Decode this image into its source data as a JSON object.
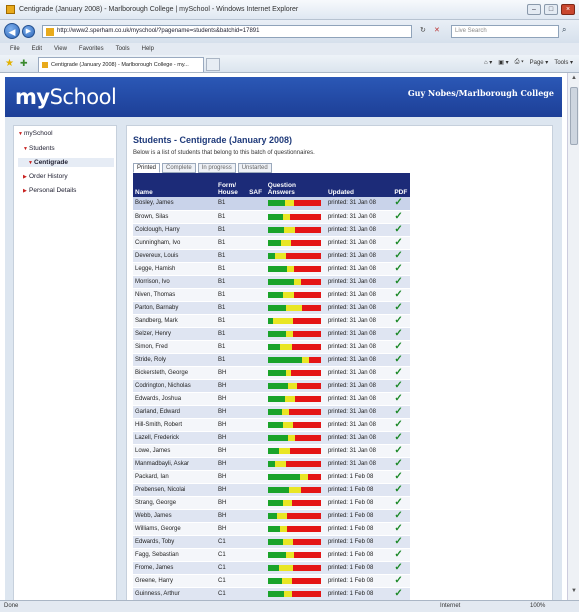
{
  "window": {
    "title": "Centigrade (January 2008) - Marlborough College | mySchool - Windows Internet Explorer",
    "min": "–",
    "max": "□",
    "close": "×"
  },
  "address_bar": {
    "url": "http://www2.sperham.co.uk/myschool/?pagename=students&batchid=17891",
    "search_placeholder": "Live Search",
    "refresh_glyph": "↻",
    "stop_glyph": "✕",
    "search_glyph": "⌕"
  },
  "menu": [
    "File",
    "Edit",
    "View",
    "Favorites",
    "Tools",
    "Help"
  ],
  "favorites_bar": {
    "tab_title": "Centigrade (January 2008) - Marlborough College - my...",
    "commands": [
      "Page ▾",
      "Tools ▾"
    ]
  },
  "header": {
    "logo_bold": "my",
    "logo_rest": "School",
    "user_college": "Guy Nobes/Marlborough College"
  },
  "sidebar": {
    "items": [
      {
        "label": "mySchool"
      },
      {
        "label": "Students"
      },
      {
        "label": "Centigrade"
      },
      {
        "label": "Order History"
      },
      {
        "label": "Personal Details"
      }
    ]
  },
  "main": {
    "title": "Students - Centigrade (January 2008)",
    "description": "Below is a list of students that belong to this batch of questionnaires.",
    "tabs": [
      "Printed",
      "Complete",
      "In progress",
      "Unstarted"
    ],
    "columns": {
      "name": "Name",
      "form": "Form/\nHouse",
      "saf": "SAF",
      "answers": "Question\nAnswers",
      "updated": "Updated",
      "pdf": "PDF"
    },
    "rows": [
      {
        "name": "Bosley, James",
        "form": "B1",
        "updated": "printed: 31 Jan 08",
        "bar": [
          0.33,
          0.16,
          0.51
        ]
      },
      {
        "name": "Brown, Silas",
        "form": "B1",
        "updated": "printed: 31 Jan 08",
        "bar": [
          0.28,
          0.14,
          0.58
        ]
      },
      {
        "name": "Colclough, Harry",
        "form": "B1",
        "updated": "printed: 31 Jan 08",
        "bar": [
          0.3,
          0.22,
          0.48
        ]
      },
      {
        "name": "Cunningham, Ivo",
        "form": "B1",
        "updated": "printed: 31 Jan 08",
        "bar": [
          0.25,
          0.18,
          0.57
        ]
      },
      {
        "name": "Devereux, Louis",
        "form": "B1",
        "updated": "printed: 31 Jan 08",
        "bar": [
          0.14,
          0.2,
          0.66
        ]
      },
      {
        "name": "Legge, Hamish",
        "form": "B1",
        "updated": "printed: 31 Jan 08",
        "bar": [
          0.36,
          0.14,
          0.5
        ]
      },
      {
        "name": "Morrison, Ivo",
        "form": "B1",
        "updated": "printed: 31 Jan 08",
        "bar": [
          0.5,
          0.12,
          0.38
        ]
      },
      {
        "name": "Niven, Thomas",
        "form": "B1",
        "updated": "printed: 31 Jan 08",
        "bar": [
          0.28,
          0.22,
          0.5
        ]
      },
      {
        "name": "Parton, Barnaby",
        "form": "B1",
        "updated": "printed: 31 Jan 08",
        "bar": [
          0.35,
          0.3,
          0.35
        ]
      },
      {
        "name": "Sandberg, Mark",
        "form": "B1",
        "updated": "printed: 31 Jan 08",
        "bar": [
          0.1,
          0.38,
          0.52
        ]
      },
      {
        "name": "Selzer, Henry",
        "form": "B1",
        "updated": "printed: 31 Jan 08",
        "bar": [
          0.35,
          0.12,
          0.53
        ]
      },
      {
        "name": "Simon, Fred",
        "form": "B1",
        "updated": "printed: 31 Jan 08",
        "bar": [
          0.24,
          0.22,
          0.54
        ]
      },
      {
        "name": "Stride, Roly",
        "form": "B1",
        "updated": "printed: 31 Jan 08",
        "bar": [
          0.65,
          0.12,
          0.23
        ]
      },
      {
        "name": "Bickersteth, George",
        "form": "BH",
        "updated": "printed: 31 Jan 08",
        "bar": [
          0.34,
          0.1,
          0.56
        ]
      },
      {
        "name": "Codrington, Nicholas",
        "form": "BH",
        "updated": "printed: 31 Jan 08",
        "bar": [
          0.38,
          0.18,
          0.44
        ]
      },
      {
        "name": "Edwards, Joshua",
        "form": "BH",
        "updated": "printed: 31 Jan 08",
        "bar": [
          0.32,
          0.2,
          0.48
        ]
      },
      {
        "name": "Garland, Edward",
        "form": "BH",
        "updated": "printed: 31 Jan 08",
        "bar": [
          0.26,
          0.14,
          0.6
        ]
      },
      {
        "name": "Hill-Smith, Robert",
        "form": "BH",
        "updated": "printed: 31 Jan 08",
        "bar": [
          0.28,
          0.2,
          0.52
        ]
      },
      {
        "name": "Lazell, Frederick",
        "form": "BH",
        "updated": "printed: 31 Jan 08",
        "bar": [
          0.38,
          0.14,
          0.48
        ]
      },
      {
        "name": "Lowe, James",
        "form": "BH",
        "updated": "printed: 31 Jan 08",
        "bar": [
          0.22,
          0.2,
          0.58
        ]
      },
      {
        "name": "Manmadbayli, Askar",
        "form": "BH",
        "updated": "printed: 31 Jan 08",
        "bar": [
          0.14,
          0.2,
          0.66
        ]
      },
      {
        "name": "Packard, Ian",
        "form": "BH",
        "updated": "printed: 1 Feb 08",
        "bar": [
          0.6,
          0.16,
          0.24
        ]
      },
      {
        "name": "Prebensen, Nicolai",
        "form": "BH",
        "updated": "printed: 1 Feb 08",
        "bar": [
          0.4,
          0.22,
          0.38
        ]
      },
      {
        "name": "Strang, George",
        "form": "BH",
        "updated": "printed: 1 Feb 08",
        "bar": [
          0.28,
          0.18,
          0.54
        ]
      },
      {
        "name": "Webb, James",
        "form": "BH",
        "updated": "printed: 1 Feb 08",
        "bar": [
          0.18,
          0.18,
          0.64
        ]
      },
      {
        "name": "Williams, George",
        "form": "BH",
        "updated": "printed: 1 Feb 08",
        "bar": [
          0.24,
          0.12,
          0.64
        ]
      },
      {
        "name": "Edwards, Toby",
        "form": "C1",
        "updated": "printed: 1 Feb 08",
        "bar": [
          0.28,
          0.2,
          0.52
        ]
      },
      {
        "name": "Fagg, Sebastian",
        "form": "C1",
        "updated": "printed: 1 Feb 08",
        "bar": [
          0.34,
          0.16,
          0.5
        ]
      },
      {
        "name": "Frome, James",
        "form": "C1",
        "updated": "printed: 1 Feb 08",
        "bar": [
          0.22,
          0.26,
          0.52
        ]
      },
      {
        "name": "Greene, Harry",
        "form": "C1",
        "updated": "printed: 1 Feb 08",
        "bar": [
          0.26,
          0.2,
          0.54
        ]
      },
      {
        "name": "Guinness, Arthur",
        "form": "C1",
        "updated": "printed: 1 Feb 08",
        "bar": [
          0.3,
          0.16,
          0.54
        ]
      }
    ],
    "pdf_glyph": "✓"
  },
  "statusbar": {
    "left": "Done",
    "zone": "Internet",
    "zoom": "100%"
  },
  "colors": {
    "header_blue": "#1d3f97",
    "table_header": "#1c2b78",
    "bar_green": "#1aa32a",
    "bar_yellow": "#e9e624",
    "bar_red": "#e41515",
    "tick_green": "#1e8a2a"
  }
}
